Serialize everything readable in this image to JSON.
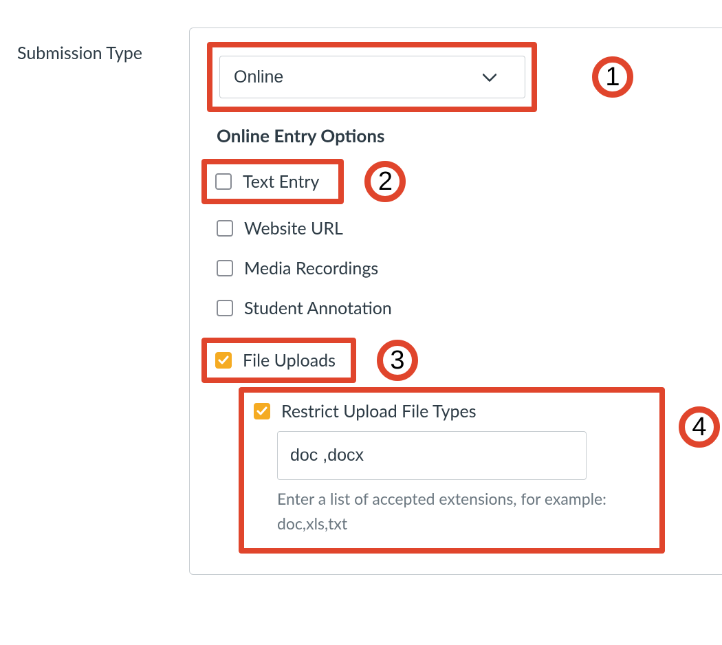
{
  "label": "Submission Type",
  "select": {
    "value": "Online"
  },
  "sectionTitle": "Online Entry Options",
  "options": [
    {
      "label": "Text Entry",
      "checked": false
    },
    {
      "label": "Website URL",
      "checked": false
    },
    {
      "label": "Media Recordings",
      "checked": false
    },
    {
      "label": "Student Annotation",
      "checked": false
    },
    {
      "label": "File Uploads",
      "checked": true
    }
  ],
  "restrict": {
    "label": "Restrict Upload File Types",
    "checked": true,
    "value": "doc ,docx",
    "help1": "Enter a list of accepted extensions, for example:",
    "help2": "doc,xls,txt"
  },
  "badges": {
    "b1": "1",
    "b2": "2",
    "b3": "3",
    "b4": "4"
  }
}
